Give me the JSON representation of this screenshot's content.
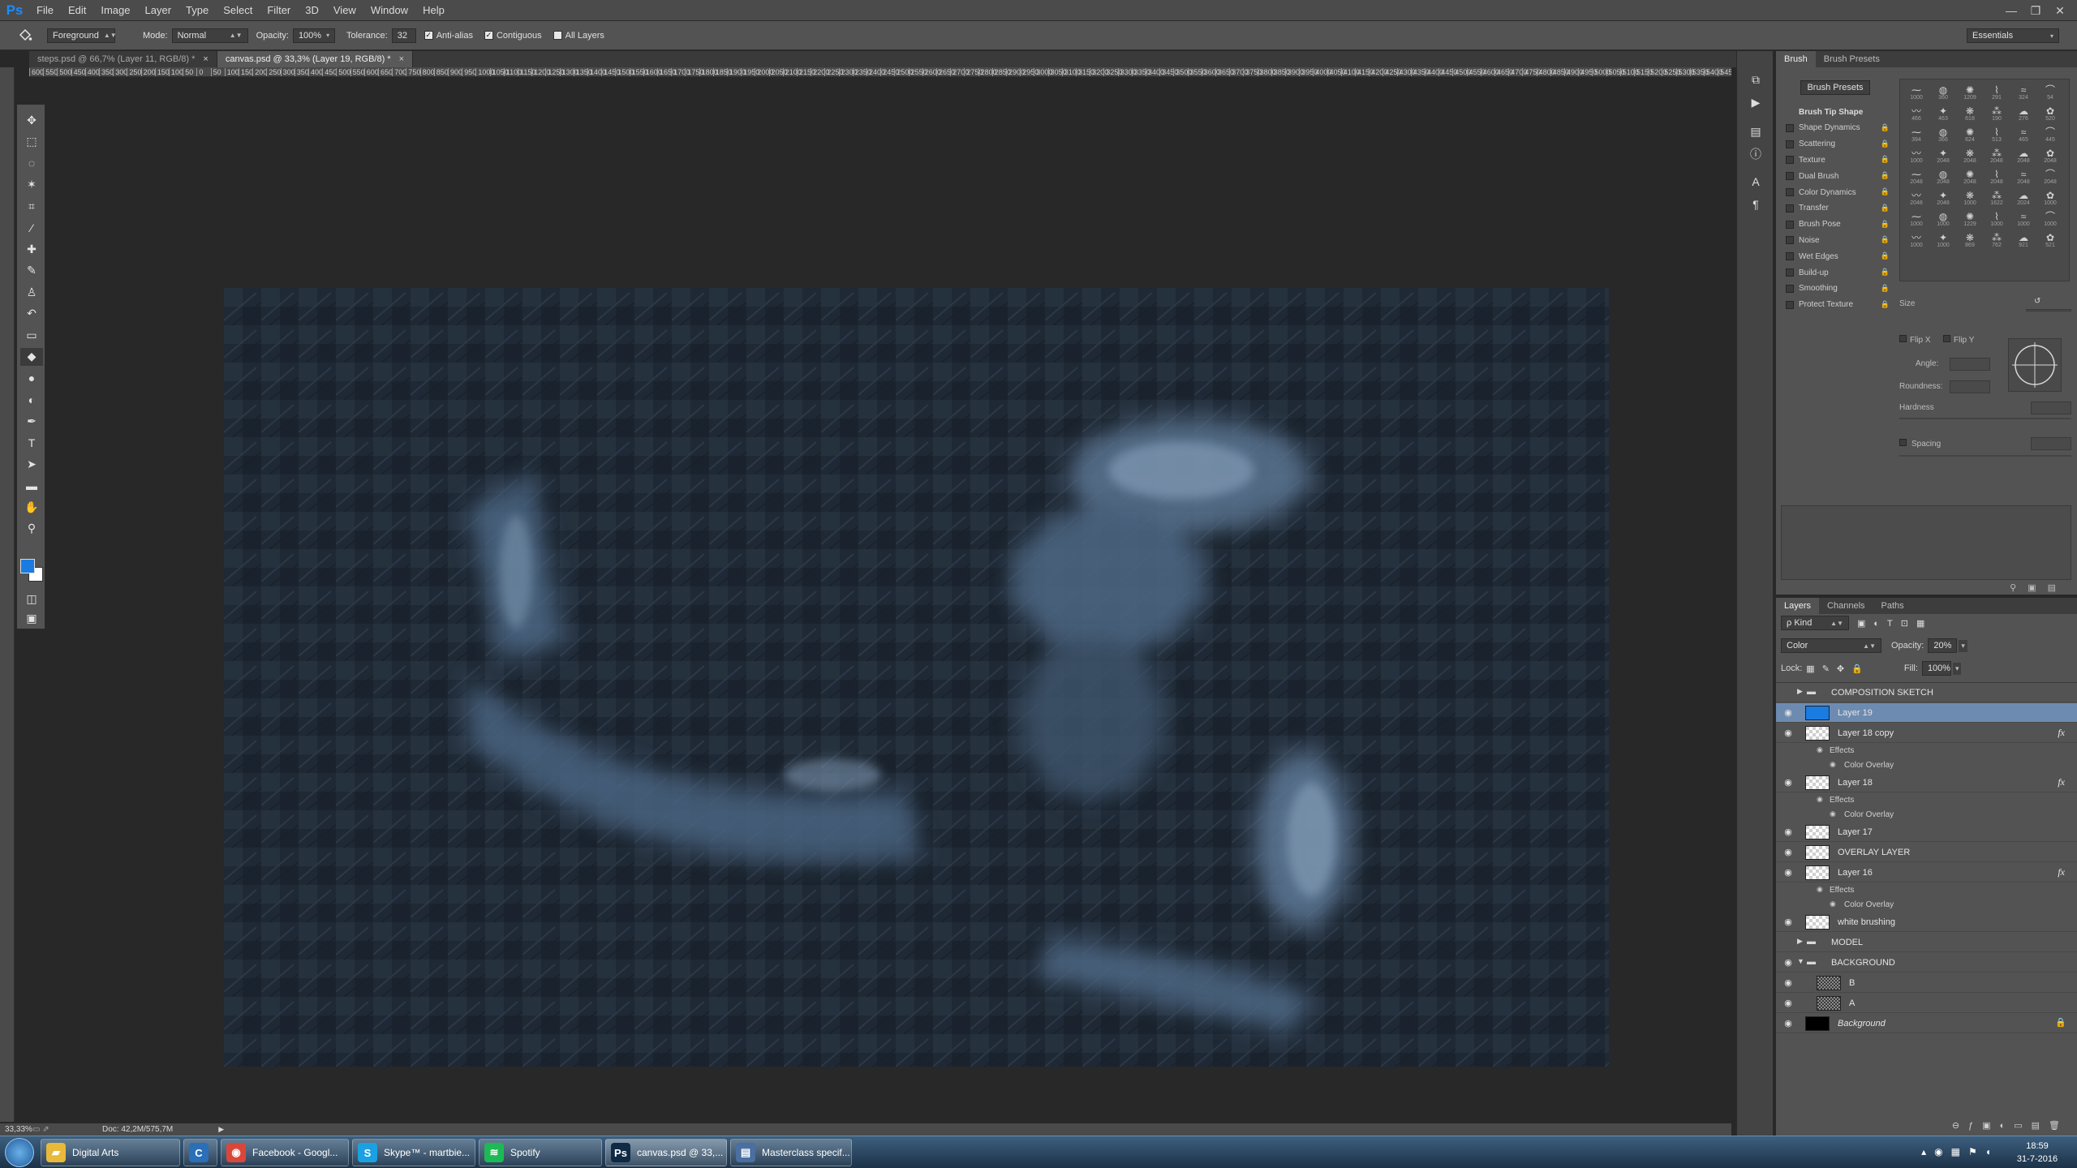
{
  "app": {
    "logo": "Ps"
  },
  "menu": [
    "File",
    "Edit",
    "Image",
    "Layer",
    "Type",
    "Select",
    "Filter",
    "3D",
    "View",
    "Window",
    "Help"
  ],
  "window_controls": {
    "minimize": "—",
    "restore": "❐",
    "close": "✕"
  },
  "options": {
    "tool_icon": "paint-bucket-icon",
    "fill_source": "Foreground",
    "mode_label": "Mode:",
    "mode_value": "Normal",
    "opacity_label": "Opacity:",
    "opacity_value": "100%",
    "tolerance_label": "Tolerance:",
    "tolerance_value": "32",
    "antialias_label": "Anti-alias",
    "contiguous_label": "Contiguous",
    "alllayers_label": "All Layers",
    "workspace": "Essentials"
  },
  "tabs": [
    {
      "label": "steps.psd @ 66,7% (Layer 11, RGB/8) *",
      "active": false
    },
    {
      "label": "canvas.psd @ 33,3% (Layer 19, RGB/8) *",
      "active": true
    }
  ],
  "ruler": [
    "600",
    "550",
    "500",
    "450",
    "400",
    "350",
    "300",
    "250",
    "200",
    "150",
    "100",
    "50",
    "0",
    "50",
    "100",
    "150",
    "200",
    "250",
    "300",
    "350",
    "400",
    "450",
    "500",
    "550",
    "600",
    "650",
    "700",
    "750",
    "800",
    "850",
    "900",
    "950",
    "1000",
    "1050",
    "1100",
    "1150",
    "1200",
    "1250",
    "1300",
    "1350",
    "1400",
    "1450",
    "1500",
    "1550",
    "1600",
    "1650",
    "1700",
    "1750",
    "1800",
    "1850",
    "1900",
    "1950",
    "2000",
    "2050",
    "2100",
    "2150",
    "2200",
    "2250",
    "2300",
    "2350",
    "2400",
    "2450",
    "2500",
    "2550",
    "2600",
    "2650",
    "2700",
    "2750",
    "2800",
    "2850",
    "2900",
    "2950",
    "3000",
    "3050",
    "3100",
    "3150",
    "3200",
    "3250",
    "3300",
    "3350",
    "3400",
    "3450",
    "3500",
    "3550",
    "3600",
    "3650",
    "3700",
    "3750",
    "3800",
    "3850",
    "3900",
    "3950",
    "4000",
    "4050",
    "4100",
    "4150",
    "4200",
    "4250",
    "4300",
    "4350",
    "4400",
    "4450",
    "4500",
    "4550",
    "4600",
    "4650",
    "4700",
    "4750",
    "4800",
    "4850",
    "4900",
    "4950",
    "5000",
    "5050",
    "5100",
    "5150",
    "5200",
    "5250",
    "5300",
    "5350",
    "5400",
    "5450",
    "5500",
    "5550",
    "5600"
  ],
  "status": {
    "zoom": "33,33%",
    "doc": "Doc: 42,2M/575,7M"
  },
  "brush": {
    "tabs": [
      "Brush",
      "Brush Presets"
    ],
    "presets_button": "Brush Presets",
    "options": [
      {
        "label": "Brush Tip Shape",
        "header": true,
        "lock": false
      },
      {
        "label": "Shape Dynamics",
        "header": false,
        "lock": true
      },
      {
        "label": "Scattering",
        "header": false,
        "lock": true
      },
      {
        "label": "Texture",
        "header": false,
        "lock": true
      },
      {
        "label": "Dual Brush",
        "header": false,
        "lock": true
      },
      {
        "label": "Color Dynamics",
        "header": false,
        "lock": true
      },
      {
        "label": "Transfer",
        "header": false,
        "lock": true
      },
      {
        "label": "Brush Pose",
        "header": false,
        "lock": true
      },
      {
        "label": "Noise",
        "header": false,
        "lock": true
      },
      {
        "label": "Wet Edges",
        "header": false,
        "lock": true
      },
      {
        "label": "Build-up",
        "header": false,
        "lock": true
      },
      {
        "label": "Smoothing",
        "header": false,
        "lock": true
      },
      {
        "label": "Protect Texture",
        "header": false,
        "lock": true
      }
    ],
    "tip_sizes": [
      "1000",
      "360",
      "1209",
      "291",
      "324",
      "54",
      "466",
      "463",
      "618",
      "190",
      "276",
      "520",
      "394",
      "366",
      "624",
      "513",
      "465",
      "445",
      "1000",
      "2048",
      "2048",
      "2048",
      "2048",
      "2048",
      "2048",
      "2048",
      "2048",
      "2048",
      "2048",
      "2048",
      "2048",
      "2048",
      "1000",
      "1622",
      "2024",
      "1000",
      "1000",
      "1000",
      "1229",
      "1000",
      "1000",
      "1000",
      "1000",
      "1000",
      "869",
      "762",
      "921",
      "521"
    ],
    "size_label": "Size",
    "flipx_label": "Flip X",
    "flipy_label": "Flip Y",
    "angle_label": "Angle:",
    "roundness_label": "Roundness:",
    "hardness_label": "Hardness",
    "spacing_label": "Spacing"
  },
  "layers": {
    "tabs": [
      "Layers",
      "Channels",
      "Paths"
    ],
    "kind_label": "ρ Kind",
    "blend_mode": "Color",
    "opacity_label": "Opacity:",
    "opacity_value": "20%",
    "lock_label": "Lock:",
    "fill_label": "Fill:",
    "fill_value": "100%",
    "rows": [
      {
        "name": "COMPOSITION SKETCH",
        "type": "group",
        "visible": false,
        "collapsed": true,
        "indent": 0
      },
      {
        "name": "Layer 19",
        "type": "layer",
        "thumb": "blue",
        "visible": true,
        "selected": true
      },
      {
        "name": "Layer 18 copy",
        "type": "layer",
        "thumb": "trans",
        "visible": true,
        "fx": "fx"
      },
      {
        "name": "Effects",
        "type": "effects"
      },
      {
        "name": "Color Overlay",
        "type": "effect"
      },
      {
        "name": "Layer 18",
        "type": "layer",
        "thumb": "trans",
        "visible": true,
        "fx": "fx"
      },
      {
        "name": "Effects",
        "type": "effects"
      },
      {
        "name": "Color Overlay",
        "type": "effect"
      },
      {
        "name": "Layer 17",
        "type": "layer",
        "thumb": "trans",
        "visible": true
      },
      {
        "name": "OVERLAY LAYER",
        "type": "layer",
        "thumb": "trans",
        "visible": true
      },
      {
        "name": "Layer 16",
        "type": "layer",
        "thumb": "trans",
        "visible": true,
        "fx": "fx"
      },
      {
        "name": "Effects",
        "type": "effects"
      },
      {
        "name": "Color Overlay",
        "type": "effect"
      },
      {
        "name": "white brushing",
        "type": "layer",
        "thumb": "trans",
        "visible": true
      },
      {
        "name": "MODEL",
        "type": "group",
        "visible": false,
        "collapsed": true
      },
      {
        "name": "BACKGROUND",
        "type": "group",
        "visible": true,
        "collapsed": false
      },
      {
        "name": "B",
        "type": "layer",
        "thumb": "noise",
        "visible": true,
        "child": true
      },
      {
        "name": "A",
        "type": "layer",
        "thumb": "noise",
        "visible": true,
        "child": true
      },
      {
        "name": "Background",
        "type": "layer",
        "thumb": "black",
        "visible": true,
        "locked": true,
        "italic": true
      }
    ]
  },
  "taskbar": {
    "items": [
      {
        "label": "Digital Arts",
        "icon": "folder-icon",
        "color": "#e8b93a",
        "glyph": "▰"
      },
      {
        "label": "",
        "icon": "ccleaner-icon",
        "color": "#2a6fb8",
        "glyph": "C"
      },
      {
        "label": "Facebook - Googl...",
        "icon": "chrome-icon",
        "color": "#d9473b",
        "glyph": "◉"
      },
      {
        "label": "Skype™ - martbie...",
        "icon": "skype-icon",
        "color": "#1ba1e2",
        "glyph": "S"
      },
      {
        "label": "Spotify",
        "icon": "spotify-icon",
        "color": "#1db954",
        "glyph": "≋"
      },
      {
        "label": "canvas.psd @ 33,...",
        "icon": "photoshop-icon",
        "color": "#0e2a44",
        "glyph": "Ps"
      },
      {
        "label": "Masterclass specif...",
        "icon": "document-icon",
        "color": "#4a6fa0",
        "glyph": "▤"
      }
    ],
    "time": "18:59",
    "date": "31-7-2016"
  }
}
